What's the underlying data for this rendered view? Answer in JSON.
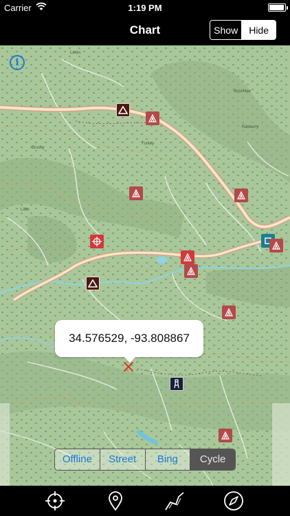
{
  "status_bar": {
    "carrier": "Carrier",
    "time": "1:19 PM",
    "wifi_icon": "wifi-icon",
    "battery_icon": "battery-icon"
  },
  "nav_bar": {
    "title": "Chart",
    "toggle": {
      "options": [
        "Show",
        "Hide"
      ],
      "selected": "Hide"
    }
  },
  "map": {
    "info_icon": "info-icon",
    "selected_point": {
      "coordinates": "34.576529, -93.808867",
      "marker_icon": "x-marker-icon"
    },
    "markers": [
      {
        "type": "peak",
        "icon": "mountain-peak-icon"
      },
      {
        "type": "campground",
        "icon": "campground-icon"
      },
      {
        "type": "campground",
        "icon": "campground-icon"
      },
      {
        "type": "campground",
        "icon": "campground-icon"
      },
      {
        "type": "target",
        "icon": "crosshair-icon"
      },
      {
        "type": "peak",
        "icon": "mountain-peak-icon"
      },
      {
        "type": "campground",
        "icon": "campground-icon"
      },
      {
        "type": "campground",
        "icon": "campground-icon"
      },
      {
        "type": "campground",
        "icon": "campground-icon"
      },
      {
        "type": "lookout-tower",
        "icon": "tower-icon"
      },
      {
        "type": "campground",
        "icon": "campground-icon"
      },
      {
        "type": "station",
        "icon": "station-icon"
      }
    ],
    "colors": {
      "land": "#a9c79a",
      "road": "#f4eab8",
      "road_casing": "#d79aa2",
      "water": "#8fd3e8",
      "accent": "#1a7ad6"
    }
  },
  "layer_selector": {
    "options": [
      "Offline",
      "Street",
      "Bing",
      "Cycle"
    ],
    "selected": "Cycle"
  },
  "tab_bar": {
    "items": [
      {
        "icon": "locate-me-icon"
      },
      {
        "icon": "location-pin-icon"
      },
      {
        "icon": "track-path-icon"
      },
      {
        "icon": "compass-icon"
      }
    ]
  }
}
